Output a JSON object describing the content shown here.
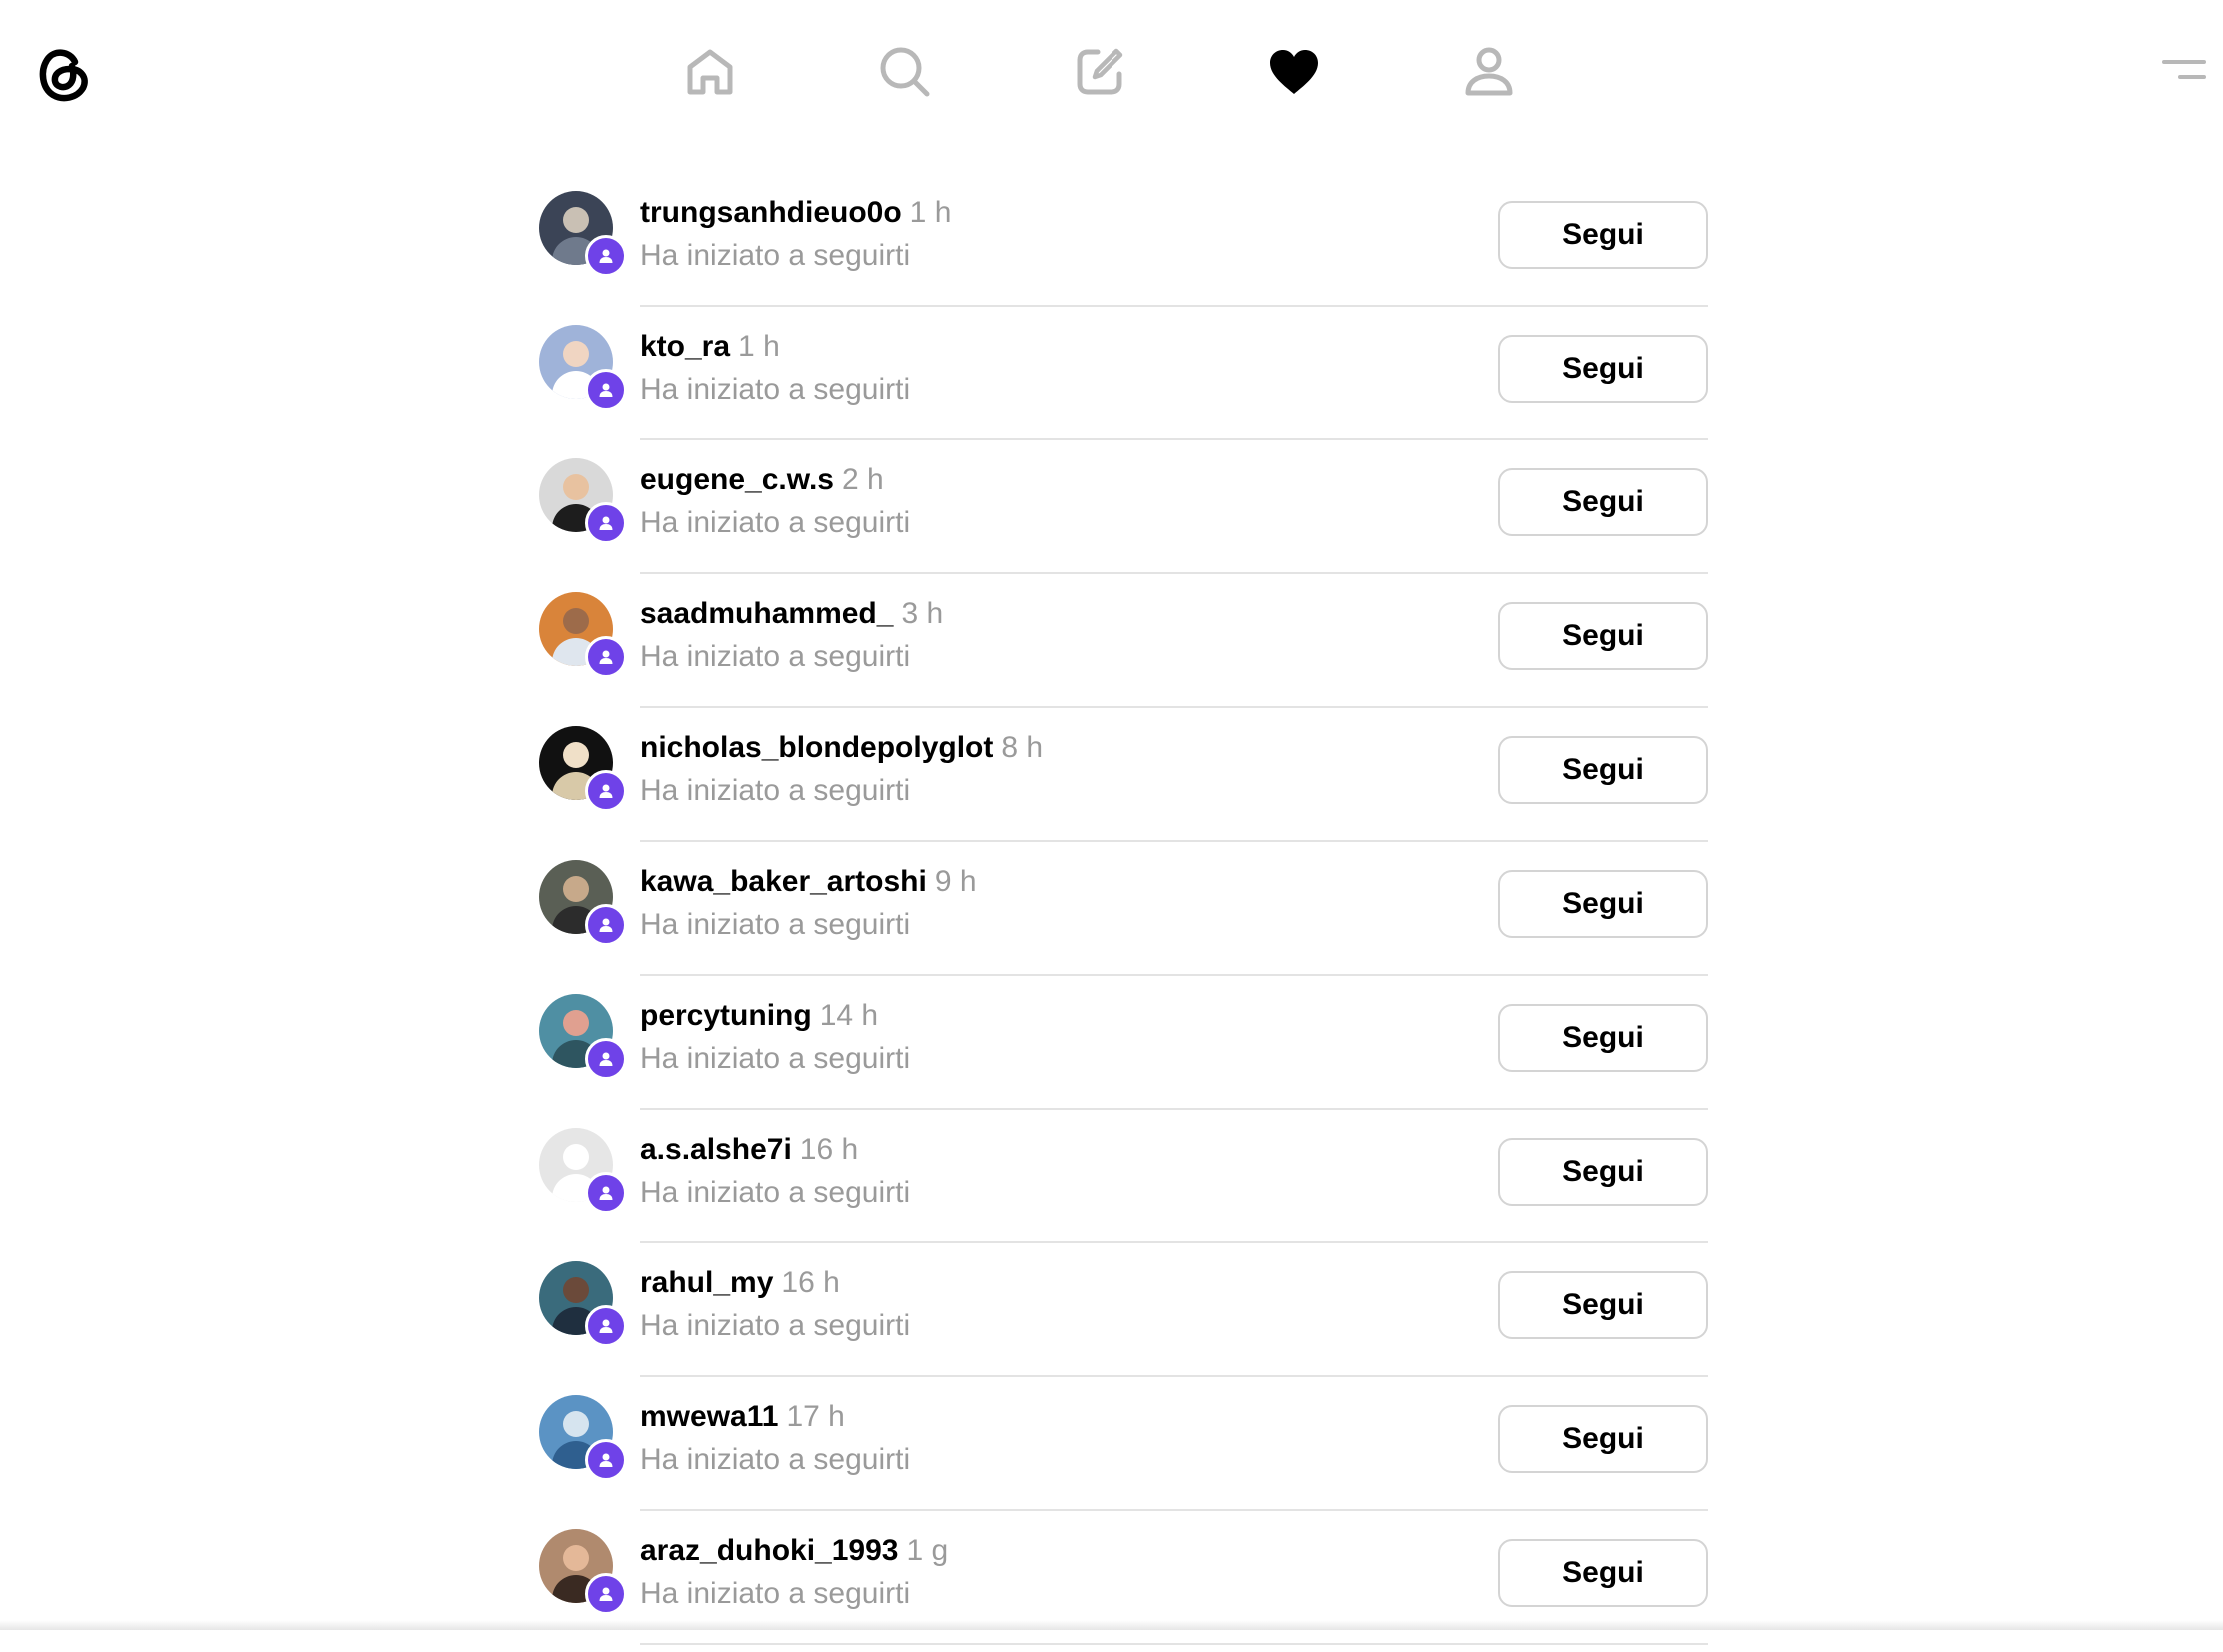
{
  "colors": {
    "badge": "#6f42e8",
    "muted_text": "#9a9a9a",
    "divider": "#e3e3e3",
    "button_border": "#d4d4d4"
  },
  "header": {
    "logo_icon": "threads-logo-icon",
    "nav": [
      {
        "icon": "home-icon",
        "active": false
      },
      {
        "icon": "search-icon",
        "active": false
      },
      {
        "icon": "compose-icon",
        "active": false
      },
      {
        "icon": "heart-icon",
        "active": true
      },
      {
        "icon": "profile-icon",
        "active": false
      }
    ],
    "menu_icon": "menu-icon"
  },
  "activity": [
    {
      "username": "trungsanhdieuo0o",
      "time": "1 h",
      "subtitle": "Ha iniziato a seguirti",
      "button": "Segui",
      "avatar_colors": [
        "#3b4456",
        "#c9c0b4",
        "#6f7a8c"
      ]
    },
    {
      "username": "kto_ra",
      "time": "1 h",
      "subtitle": "Ha iniziato a seguirti",
      "button": "Segui",
      "avatar_colors": [
        "#9fb3d9",
        "#f0d5c2",
        "#ffffff"
      ]
    },
    {
      "username": "eugene_c.w.s",
      "time": "2 h",
      "subtitle": "Ha iniziato a seguirti",
      "button": "Segui",
      "avatar_colors": [
        "#d9d9d9",
        "#e8c2a0",
        "#1d1d1d"
      ]
    },
    {
      "username": "saadmuhammed_",
      "time": "3 h",
      "subtitle": "Ha iniziato a seguirti",
      "button": "Segui",
      "avatar_colors": [
        "#d9843a",
        "#9d6b4a",
        "#dfe6ee"
      ]
    },
    {
      "username": "nicholas_blondepolyglot",
      "time": "8 h",
      "subtitle": "Ha iniziato a seguirti",
      "button": "Segui",
      "avatar_colors": [
        "#111111",
        "#f0e0c8",
        "#d8c9a8"
      ]
    },
    {
      "username": "kawa_baker_artoshi",
      "time": "9 h",
      "subtitle": "Ha iniziato a seguirti",
      "button": "Segui",
      "avatar_colors": [
        "#5a5f55",
        "#c7a98a",
        "#2c2c2c"
      ]
    },
    {
      "username": "percytuning",
      "time": "14 h",
      "subtitle": "Ha iniziato a seguirti",
      "button": "Segui",
      "avatar_colors": [
        "#4f8fa3",
        "#e0a090",
        "#2e5560"
      ]
    },
    {
      "username": "a.s.alshe7i",
      "time": "16 h",
      "subtitle": "Ha iniziato a seguirti",
      "button": "Segui",
      "avatar_colors": [
        "#e6e6e6",
        "#ffffff",
        "#ffffff"
      ]
    },
    {
      "username": "rahul_my",
      "time": "16 h",
      "subtitle": "Ha iniziato a seguirti",
      "button": "Segui",
      "avatar_colors": [
        "#3a6b7c",
        "#6b4a3a",
        "#1f2f3f"
      ]
    },
    {
      "username": "mwewa11",
      "time": "17 h",
      "subtitle": "Ha iniziato a seguirti",
      "button": "Segui",
      "avatar_colors": [
        "#5b93c4",
        "#d6e4ef",
        "#2f5f8f"
      ]
    },
    {
      "username": "araz_duhoki_1993",
      "time": "1 g",
      "subtitle": "Ha iniziato a seguirti",
      "button": "Segui",
      "avatar_colors": [
        "#b08a6e",
        "#e4b898",
        "#3a2a22"
      ]
    }
  ]
}
